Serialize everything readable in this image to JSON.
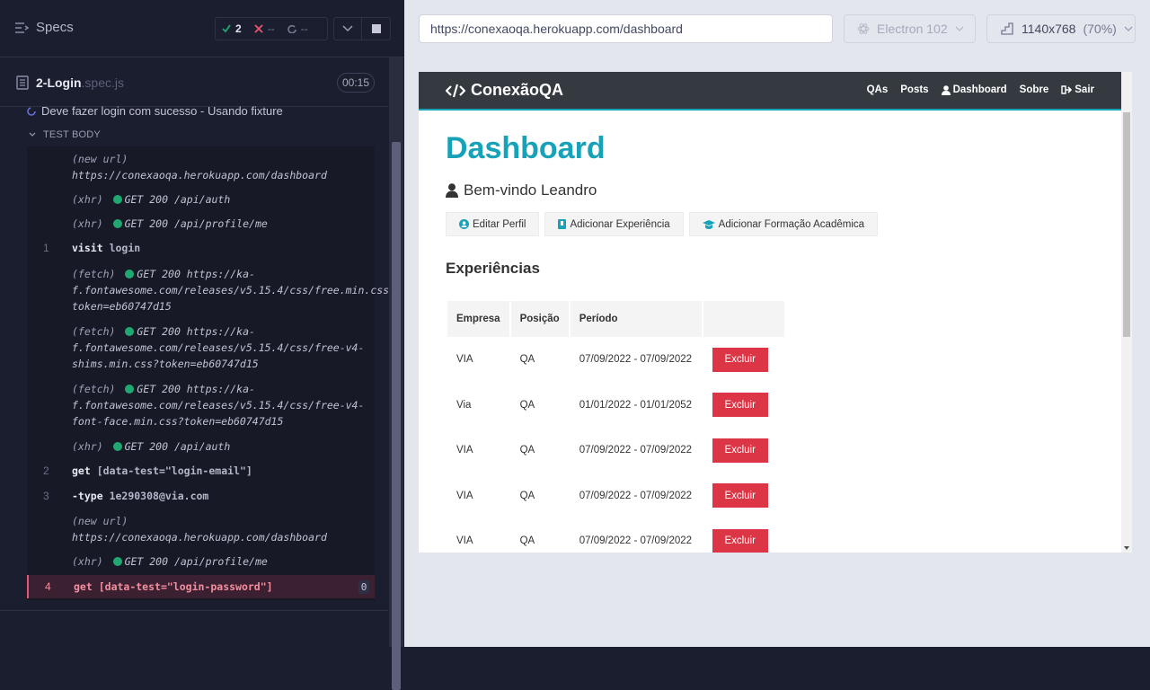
{
  "reporter": {
    "header": {
      "specs_label": "Specs",
      "passed": "2",
      "failed": "--",
      "pending": "--"
    },
    "spec": {
      "file_name": "2-Login",
      "file_ext": ".spec.js",
      "duration": "00:15"
    },
    "test_title": "Deve fazer login com sucesso - Usando fixture",
    "test_body_label": "TEST BODY",
    "commands": [
      {
        "num": "",
        "label": "(new url)",
        "body": "https://conexaoqa.herokuapp.com/dashboard"
      },
      {
        "num": "",
        "label": "(xhr)",
        "body": "GET 200 /api/auth"
      },
      {
        "num": "",
        "label": "(xhr)",
        "body": "GET 200 /api/profile/me"
      },
      {
        "num": "1",
        "name": "visit",
        "arg": "login"
      },
      {
        "num": "",
        "label": "(fetch)",
        "body": "GET 200 https://ka-f.fontawesome.com/releases/v5.15.4/css/free.min.css?token=eb60747d15"
      },
      {
        "num": "",
        "label": "(fetch)",
        "body": "GET 200 https://ka-f.fontawesome.com/releases/v5.15.4/css/free-v4-shims.min.css?token=eb60747d15"
      },
      {
        "num": "",
        "label": "(fetch)",
        "body": "GET 200 https://ka-f.fontawesome.com/releases/v5.15.4/css/free-v4-font-face.min.css?token=eb60747d15"
      },
      {
        "num": "",
        "label": "(xhr)",
        "body": "GET 200 /api/auth"
      },
      {
        "num": "2",
        "name": "get",
        "arg": "[data-test=\"login-email\"]"
      },
      {
        "num": "3",
        "name": "-type",
        "arg": "1e290308@via.com"
      },
      {
        "num": "",
        "label": "(new url)",
        "body": "https://conexaoqa.herokuapp.com/dashboard"
      },
      {
        "num": "",
        "label": "(xhr)",
        "body": "GET 200 /api/profile/me"
      },
      {
        "num": "4",
        "name": "get",
        "arg": "[data-test=\"login-password\"]",
        "badge": "0"
      }
    ]
  },
  "aut": {
    "url": "https://conexaoqa.herokuapp.com/dashboard",
    "browser": "Electron 102",
    "viewport": "1140x768",
    "zoom": "(70%)",
    "site": {
      "brand": "ConexãoQA",
      "nav": [
        "QAs",
        "Posts",
        "Dashboard",
        "Sobre",
        "Sair"
      ],
      "title": "Dashboard",
      "welcome": "Bem-vindo Leandro",
      "actions": [
        "Editar Perfil",
        "Adicionar Experiência",
        "Adicionar Formação Acadêmica"
      ],
      "experiences_title": "Experiências",
      "table_headers": [
        "Empresa",
        "Posição",
        "Período",
        ""
      ],
      "delete_label": "Excluir",
      "rows": [
        {
          "empresa": "VIA",
          "posicao": "QA",
          "periodo": "07/09/2022 - 07/09/2022"
        },
        {
          "empresa": "Via",
          "posicao": "QA",
          "periodo": "01/01/2022 - 01/01/2052"
        },
        {
          "empresa": "VIA",
          "posicao": "QA",
          "periodo": "07/09/2022 - 07/09/2022"
        },
        {
          "empresa": "VIA",
          "posicao": "QA",
          "periodo": "07/09/2022 - 07/09/2022"
        },
        {
          "empresa": "VIA",
          "posicao": "QA",
          "periodo": "07/09/2022 - 07/09/2022"
        }
      ]
    }
  },
  "colors": {
    "accent": "#17a2b8",
    "danger": "#dc3545",
    "pass": "#1fa971",
    "fail": "#e45770"
  }
}
